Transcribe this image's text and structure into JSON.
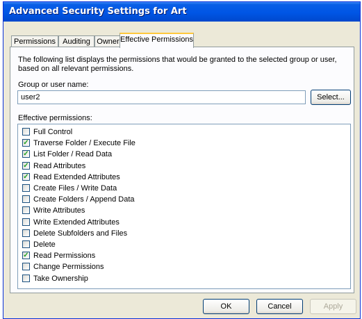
{
  "window": {
    "title": "Advanced Security Settings for Art"
  },
  "tabs": [
    {
      "label": "Permissions",
      "active": false
    },
    {
      "label": "Auditing",
      "active": false
    },
    {
      "label": "Owner",
      "active": false
    },
    {
      "label": "Effective Permissions",
      "active": true
    }
  ],
  "panel": {
    "description": "The following list displays the permissions that would be granted to the selected group or user, based on all relevant permissions.",
    "group_label": "Group or user name:",
    "user_value": "user2",
    "select_button": "Select...",
    "effective_label": "Effective permissions:",
    "permissions": [
      {
        "label": "Full Control",
        "checked": false
      },
      {
        "label": "Traverse Folder / Execute File",
        "checked": true
      },
      {
        "label": "List Folder / Read Data",
        "checked": true
      },
      {
        "label": "Read Attributes",
        "checked": true
      },
      {
        "label": "Read Extended Attributes",
        "checked": true
      },
      {
        "label": "Create Files / Write Data",
        "checked": false
      },
      {
        "label": "Create Folders / Append Data",
        "checked": false
      },
      {
        "label": "Write Attributes",
        "checked": false
      },
      {
        "label": "Write Extended Attributes",
        "checked": false
      },
      {
        "label": "Delete Subfolders and Files",
        "checked": false
      },
      {
        "label": "Delete",
        "checked": false
      },
      {
        "label": "Read Permissions",
        "checked": true
      },
      {
        "label": "Change Permissions",
        "checked": false
      },
      {
        "label": "Take Ownership",
        "checked": false
      }
    ]
  },
  "buttons": {
    "ok": "OK",
    "cancel": "Cancel",
    "apply": "Apply",
    "apply_enabled": false
  },
  "colors": {
    "titlebar": "#0055e5",
    "active_tab_accent": "#ffc83c",
    "dialog_face": "#ece9d8",
    "checkmark": "#21a121"
  }
}
